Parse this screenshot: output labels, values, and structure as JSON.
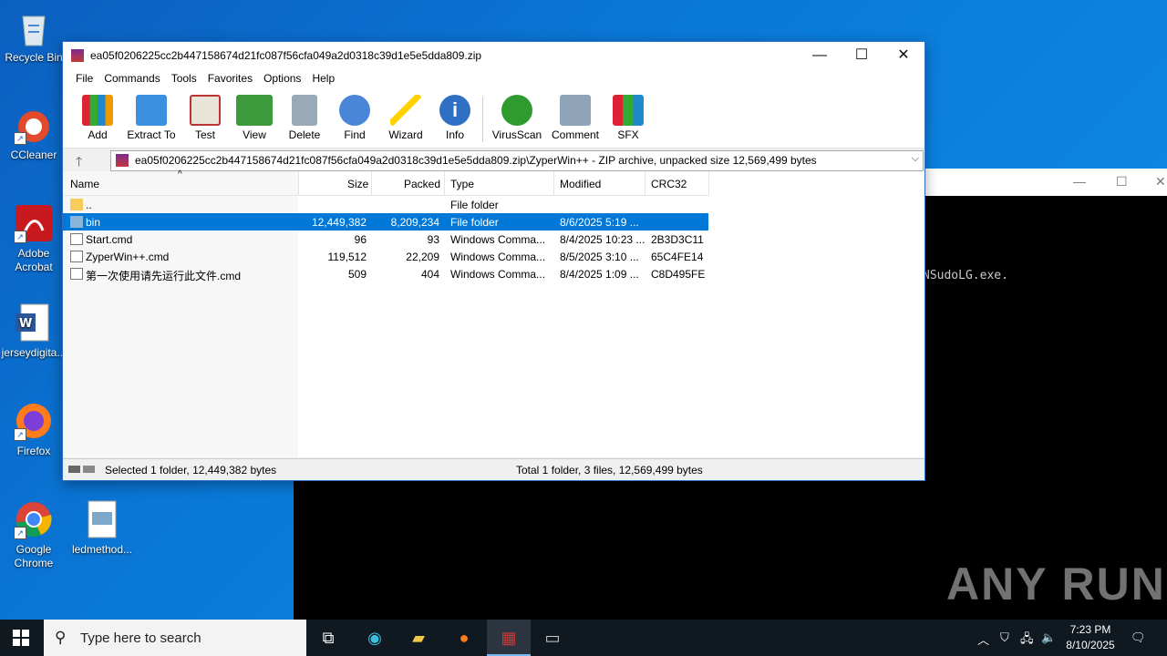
{
  "desktop": {
    "icons": [
      {
        "label": "Recycle Bin"
      },
      {
        "label": "CCleaner"
      },
      {
        "label": "Adobe Acrobat"
      },
      {
        "label": "jerseydigita..."
      },
      {
        "label": "Firefox"
      },
      {
        "label": "Google Chrome"
      },
      {
        "label": "ledmethod..."
      }
    ]
  },
  "console": {
    "text": "NSudoLG.exe.",
    "watermark": "ANY RUN"
  },
  "winrar": {
    "title": "ea05f0206225cc2b447158674d21fc087f56cfa049a2d0318c39d1e5e5dda809.zip",
    "menu": [
      "File",
      "Commands",
      "Tools",
      "Favorites",
      "Options",
      "Help"
    ],
    "toolbar": [
      "Add",
      "Extract To",
      "Test",
      "View",
      "Delete",
      "Find",
      "Wizard",
      "Info",
      "VirusScan",
      "Comment",
      "SFX"
    ],
    "address": "ea05f0206225cc2b447158674d21fc087f56cfa049a2d0318c39d1e5e5dda809.zip\\ZyperWin++ - ZIP archive, unpacked size 12,569,499 bytes",
    "columns": [
      "Name",
      "Size",
      "Packed",
      "Type",
      "Modified",
      "CRC32"
    ],
    "rows": [
      {
        "name": "..",
        "size": "",
        "packed": "",
        "type": "File folder",
        "modified": "",
        "crc": ""
      },
      {
        "name": "bin",
        "size": "12,449,382",
        "packed": "8,209,234",
        "type": "File folder",
        "modified": "8/6/2025 5:19 ...",
        "crc": ""
      },
      {
        "name": "Start.cmd",
        "size": "96",
        "packed": "93",
        "type": "Windows Comma...",
        "modified": "8/4/2025 10:23 ...",
        "crc": "2B3D3C11"
      },
      {
        "name": "ZyperWin++.cmd",
        "size": "119,512",
        "packed": "22,209",
        "type": "Windows Comma...",
        "modified": "8/5/2025 3:10 ...",
        "crc": "65C4FE14"
      },
      {
        "name": "第一次使用请先运行此文件.cmd",
        "size": "509",
        "packed": "404",
        "type": "Windows Comma...",
        "modified": "8/4/2025 1:09 ...",
        "crc": "C8D495FE"
      }
    ],
    "status_left": "Selected 1 folder, 12,449,382 bytes",
    "status_right": "Total 1 folder, 3 files, 12,569,499 bytes"
  },
  "taskbar": {
    "search_placeholder": "Type here to search",
    "time": "7:23 PM",
    "date": "8/10/2025"
  }
}
